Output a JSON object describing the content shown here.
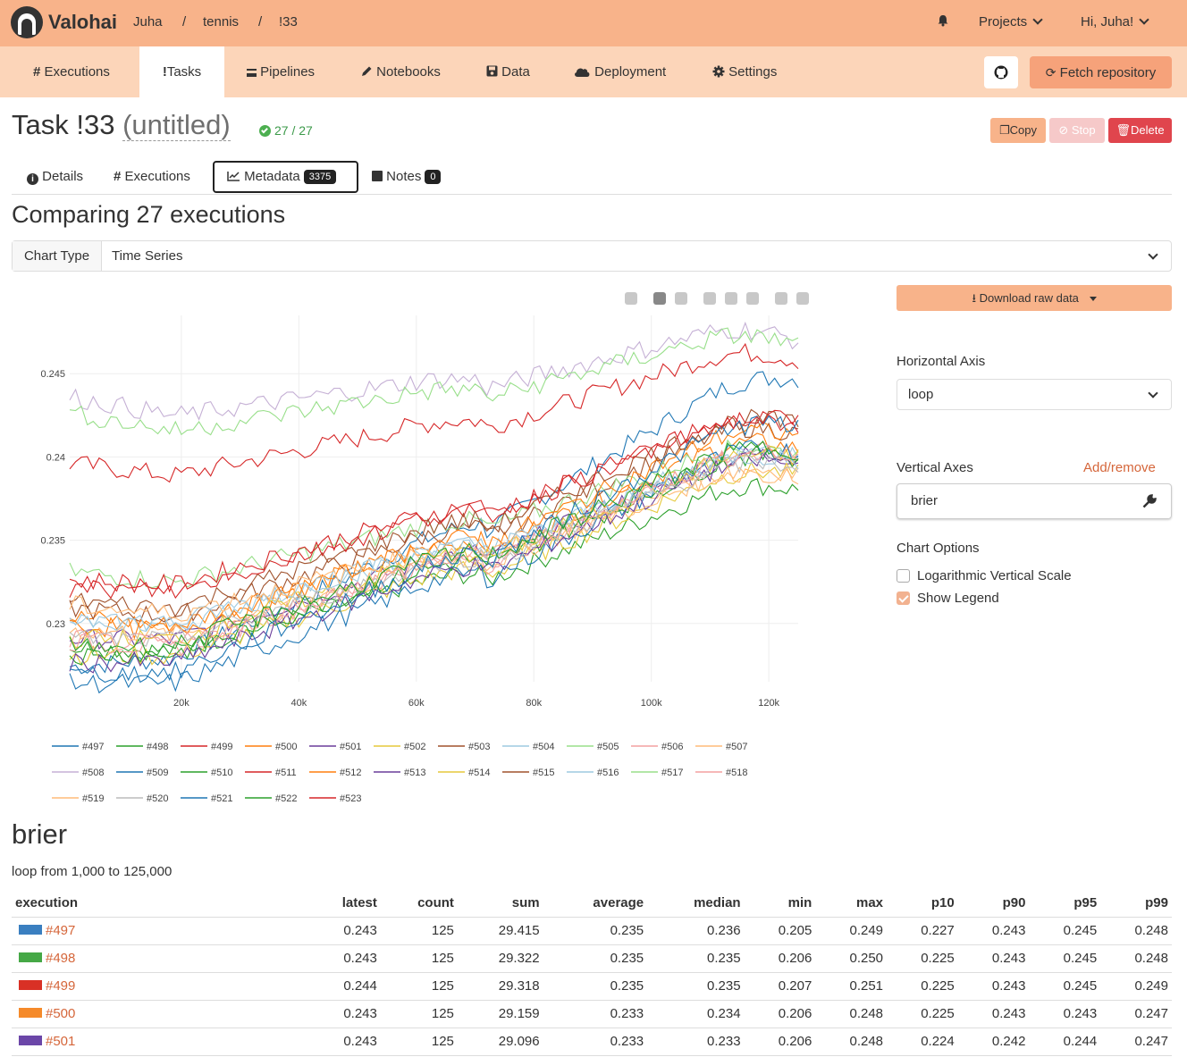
{
  "header": {
    "brand": "Valohai",
    "breadcrumbs": [
      "Juha",
      "/",
      "tennis",
      "/",
      "!33"
    ],
    "projects_label": "Projects",
    "user_label": "Hi, Juha!"
  },
  "nav": {
    "items": [
      {
        "icon": "hash-icon",
        "label": "Executions"
      },
      {
        "icon": "exclamation-icon",
        "label": "Tasks"
      },
      {
        "icon": "pipelines-icon",
        "label": "Pipelines"
      },
      {
        "icon": "pencil-icon",
        "label": "Notebooks"
      },
      {
        "icon": "database-icon",
        "label": "Data"
      },
      {
        "icon": "cloud-icon",
        "label": "Deployment"
      },
      {
        "icon": "gear-icon",
        "label": "Settings"
      }
    ],
    "active": "Tasks",
    "fetch_label": "Fetch repository"
  },
  "task": {
    "title_prefix": "Task !33",
    "title_name": "(untitled)",
    "progress": "27 / 27",
    "copy_label": "Copy",
    "stop_label": "Stop",
    "delete_label": "Delete"
  },
  "tabs": {
    "details": "Details",
    "executions": "Executions",
    "metadata": "Metadata",
    "metadata_count": "3375",
    "notes": "Notes",
    "notes_count": "0"
  },
  "compare": {
    "heading": "Comparing 27 executions",
    "chart_type_label": "Chart Type",
    "chart_type_value": "Time Series"
  },
  "panel": {
    "download_label": "Download raw data",
    "horizontal_axis_label": "Horizontal Axis",
    "horizontal_axis_value": "loop",
    "vertical_axes_label": "Vertical Axes",
    "add_remove_label": "Add/remove",
    "vertical_axes_value": "brier",
    "chart_options_label": "Chart Options",
    "log_scale_label": "Logarithmic Vertical Scale",
    "log_scale_checked": false,
    "show_legend_label": "Show Legend",
    "show_legend_checked": true
  },
  "chart_data": {
    "type": "line",
    "x_range": [
      1000,
      125000
    ],
    "ylim": [
      0.2265,
      0.2485
    ],
    "x_ticks": [
      20000,
      40000,
      60000,
      80000,
      100000,
      120000
    ],
    "x_tick_labels": [
      "20k",
      "40k",
      "60k",
      "80k",
      "100k",
      "120k"
    ],
    "y_ticks": [
      0.23,
      0.235,
      0.24,
      0.245
    ],
    "y_tick_labels": [
      "0.23",
      "0.235",
      "0.24",
      "0.245"
    ],
    "grid": true,
    "legend_position": "bottom",
    "series": [
      {
        "name": "#497",
        "color": "#1f77b4",
        "start": 0.2285,
        "end": 0.243
      },
      {
        "name": "#498",
        "color": "#2ca02c",
        "start": 0.2295,
        "end": 0.2358
      },
      {
        "name": "#499",
        "color": "#d62728",
        "start": 0.2405,
        "end": 0.243
      },
      {
        "name": "#500",
        "color": "#ff7f0e",
        "start": 0.2315,
        "end": 0.2375
      },
      {
        "name": "#501",
        "color": "#6a3d9a",
        "start": 0.23,
        "end": 0.238
      },
      {
        "name": "#502",
        "color": "#e6c93c",
        "start": 0.229,
        "end": 0.237
      },
      {
        "name": "#503",
        "color": "#a0522d",
        "start": 0.232,
        "end": 0.2385
      },
      {
        "name": "#504",
        "color": "#9ecae1",
        "start": 0.231,
        "end": 0.2378
      },
      {
        "name": "#505",
        "color": "#98df8a",
        "start": 0.234,
        "end": 0.2375
      },
      {
        "name": "#506",
        "color": "#f4a0a0",
        "start": 0.23,
        "end": 0.2372
      },
      {
        "name": "#507",
        "color": "#ffbb78",
        "start": 0.2305,
        "end": 0.2368
      },
      {
        "name": "#508",
        "color": "#c5b0d5",
        "start": 0.2445,
        "end": 0.2437
      },
      {
        "name": "#509",
        "color": "#1f77b4",
        "start": 0.2275,
        "end": 0.238
      },
      {
        "name": "#510",
        "color": "#2ca02c",
        "start": 0.229,
        "end": 0.2382
      },
      {
        "name": "#511",
        "color": "#d62728",
        "start": 0.2335,
        "end": 0.2397
      },
      {
        "name": "#512",
        "color": "#ff7f0e",
        "start": 0.231,
        "end": 0.2385
      },
      {
        "name": "#513",
        "color": "#6a3d9a",
        "start": 0.2285,
        "end": 0.2379
      },
      {
        "name": "#514",
        "color": "#e6c93c",
        "start": 0.23,
        "end": 0.238
      },
      {
        "name": "#515",
        "color": "#a0522d",
        "start": 0.2325,
        "end": 0.239
      },
      {
        "name": "#516",
        "color": "#9ecae1",
        "start": 0.2312,
        "end": 0.2376
      },
      {
        "name": "#517",
        "color": "#98df8a",
        "start": 0.2435,
        "end": 0.2435
      },
      {
        "name": "#518",
        "color": "#f4a0a0",
        "start": 0.2302,
        "end": 0.237
      },
      {
        "name": "#519",
        "color": "#ffbb78",
        "start": 0.232,
        "end": 0.2362
      },
      {
        "name": "#520",
        "color": "#bbbbbb",
        "start": 0.23,
        "end": 0.2374
      },
      {
        "name": "#521",
        "color": "#1f77b4",
        "start": 0.228,
        "end": 0.2398
      },
      {
        "name": "#522",
        "color": "#2ca02c",
        "start": 0.2295,
        "end": 0.2386
      },
      {
        "name": "#523",
        "color": "#d62728",
        "start": 0.233,
        "end": 0.24
      }
    ]
  },
  "stats": {
    "title": "brier",
    "subtitle": "loop from 1,000 to 125,000",
    "columns": [
      "execution",
      "latest",
      "count",
      "sum",
      "average",
      "median",
      "min",
      "max",
      "p10",
      "p90",
      "p95",
      "p99"
    ],
    "rows": [
      {
        "execution": "#497",
        "color": "#3a7fc0",
        "values": [
          "0.243",
          "125",
          "29.415",
          "0.235",
          "0.236",
          "0.205",
          "0.249",
          "0.227",
          "0.243",
          "0.245",
          "0.248"
        ]
      },
      {
        "execution": "#498",
        "color": "#45a846",
        "values": [
          "0.243",
          "125",
          "29.322",
          "0.235",
          "0.235",
          "0.206",
          "0.250",
          "0.225",
          "0.243",
          "0.245",
          "0.248"
        ]
      },
      {
        "execution": "#499",
        "color": "#d93025",
        "values": [
          "0.244",
          "125",
          "29.318",
          "0.235",
          "0.235",
          "0.207",
          "0.251",
          "0.225",
          "0.243",
          "0.245",
          "0.249"
        ]
      },
      {
        "execution": "#500",
        "color": "#f58a2a",
        "values": [
          "0.243",
          "125",
          "29.159",
          "0.233",
          "0.234",
          "0.206",
          "0.248",
          "0.225",
          "0.243",
          "0.243",
          "0.247"
        ]
      },
      {
        "execution": "#501",
        "color": "#6b46a8",
        "values": [
          "0.243",
          "125",
          "29.096",
          "0.233",
          "0.233",
          "0.206",
          "0.248",
          "0.224",
          "0.242",
          "0.244",
          "0.247"
        ]
      }
    ]
  }
}
